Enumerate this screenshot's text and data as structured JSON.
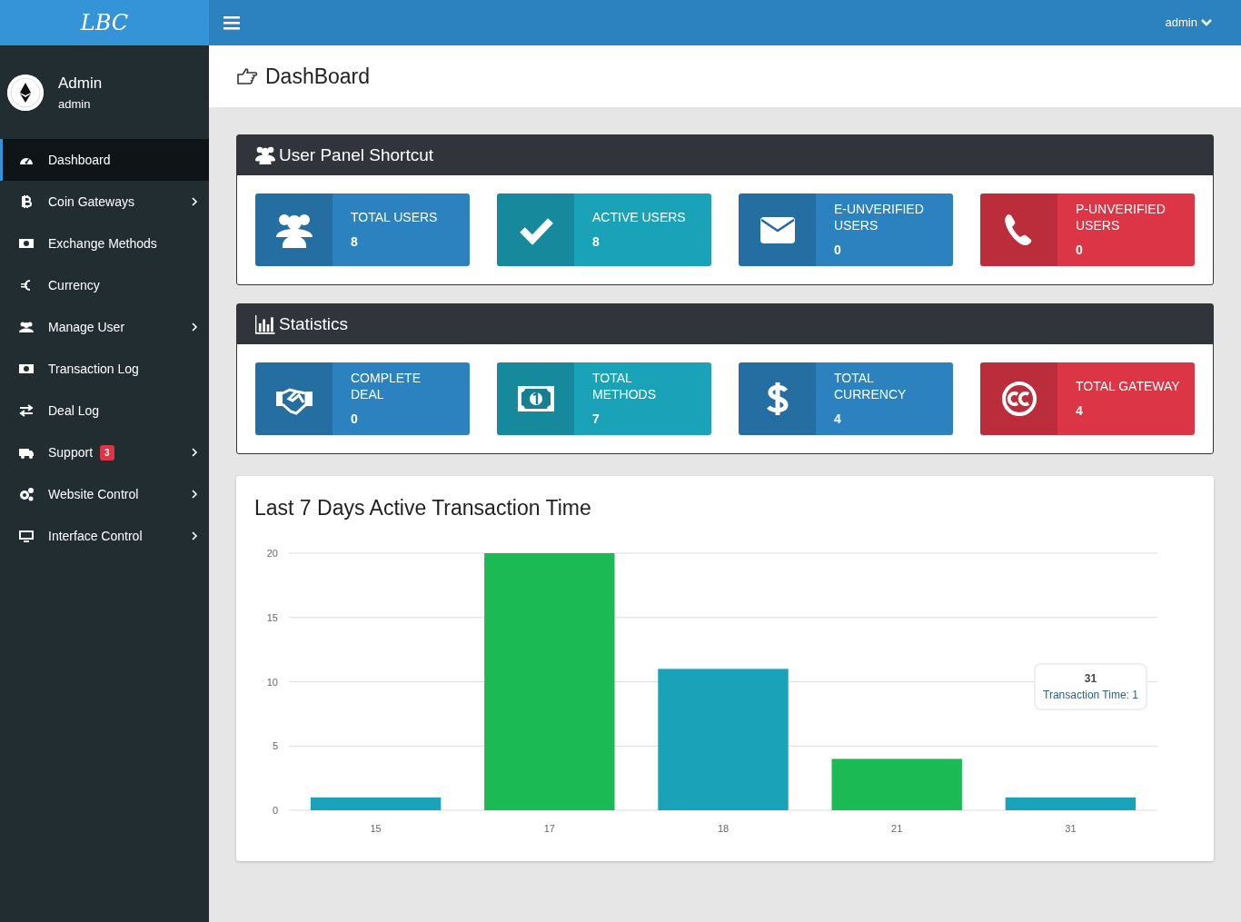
{
  "brand": "LBC",
  "topbar": {
    "user": "admin"
  },
  "profile": {
    "name": "Admin",
    "role": "admin"
  },
  "sidebar": {
    "items": [
      {
        "label": "Dashboard",
        "selected": true,
        "expandable": false
      },
      {
        "label": "Coin Gateways",
        "selected": false,
        "expandable": true
      },
      {
        "label": "Exchange Methods",
        "selected": false,
        "expandable": false
      },
      {
        "label": "Currency",
        "selected": false,
        "expandable": false
      },
      {
        "label": "Manage User",
        "selected": false,
        "expandable": true
      },
      {
        "label": "Transaction Log",
        "selected": false,
        "expandable": false
      },
      {
        "label": "Deal Log",
        "selected": false,
        "expandable": false
      },
      {
        "label": "Support",
        "selected": false,
        "expandable": true,
        "badge": "3"
      },
      {
        "label": "Website Control",
        "selected": false,
        "expandable": true
      },
      {
        "label": "Interface Control",
        "selected": false,
        "expandable": true
      }
    ]
  },
  "page_title": "DashBoard",
  "panels": [
    {
      "title": "User Panel Shortcut",
      "tiles": [
        {
          "label": "TOTAL USERS",
          "value": "8",
          "color": "#2c82bf"
        },
        {
          "label": "ACTIVE USERS",
          "value": "8",
          "color": "#1aa3b8"
        },
        {
          "label": "E-UNVERIFIED USERS",
          "value": "0",
          "color": "#2c82bf"
        },
        {
          "label": "P-UNVERIFIED USERS",
          "value": "0",
          "color": "#dc3545"
        }
      ]
    },
    {
      "title": "Statistics",
      "tiles": [
        {
          "label": "COMPLETE DEAL",
          "value": "0",
          "color": "#2c82bf"
        },
        {
          "label": "TOTAL METHODS",
          "value": "7",
          "color": "#1aa3b8"
        },
        {
          "label": "TOTAL CURRENCY",
          "value": "4",
          "color": "#2c82bf"
        },
        {
          "label": "TOTAL GATEWAY",
          "value": "4",
          "color": "#dc3545"
        }
      ]
    }
  ],
  "chart_card": {
    "title": "Last 7 Days Active Transaction Time",
    "chart_data": {
      "type": "bar",
      "categories": [
        "15",
        "17",
        "18",
        "21",
        "31"
      ],
      "series": [
        {
          "color": "#1aa3b8",
          "values": [
            1,
            null,
            11,
            null,
            1
          ]
        },
        {
          "color": "#1cba55",
          "values": [
            null,
            20,
            null,
            4,
            null
          ]
        }
      ],
      "ylim": [
        0,
        20
      ],
      "yticks": [
        0,
        5,
        10,
        15,
        20
      ],
      "grid": true
    },
    "tooltip": {
      "title": "31",
      "label": "Transaction Time: 1"
    }
  }
}
